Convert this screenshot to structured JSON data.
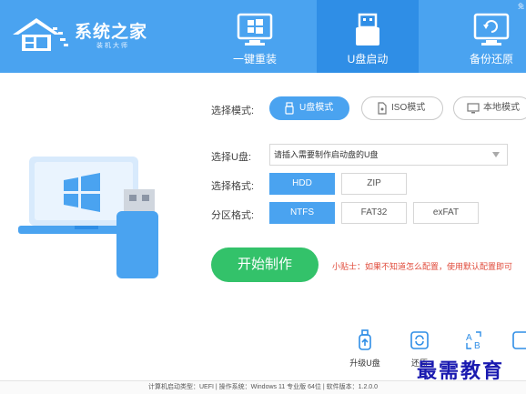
{
  "app": {
    "title": "系统之家",
    "subtitle": "装机大师",
    "corner_text": "免"
  },
  "nav": {
    "tabs": [
      {
        "label": "一键重装",
        "icon": "windows-monitor-icon",
        "active": false
      },
      {
        "label": "U盘启动",
        "icon": "usb-drive-icon",
        "active": true
      },
      {
        "label": "备份还原",
        "icon": "backup-restore-icon",
        "active": false
      }
    ]
  },
  "mode": {
    "label": "选择模式:",
    "options": [
      {
        "label": "U盘模式",
        "icon": "usb-icon",
        "active": true
      },
      {
        "label": "ISO模式",
        "icon": "disc-icon",
        "active": false
      },
      {
        "label": "本地模式",
        "icon": "monitor-icon",
        "active": false
      }
    ]
  },
  "usb_select": {
    "label": "选择U盘:",
    "value": "请插入需要制作启动盘的U盘"
  },
  "format": {
    "label": "选择格式:",
    "options": [
      {
        "label": "HDD",
        "active": true
      },
      {
        "label": "ZIP",
        "active": false
      }
    ]
  },
  "partition": {
    "label": "分区格式:",
    "options": [
      {
        "label": "NTFS",
        "active": true
      },
      {
        "label": "FAT32",
        "active": false
      },
      {
        "label": "exFAT",
        "active": false
      }
    ]
  },
  "start_button": "开始制作",
  "tip": "小贴士：如果不知道怎么配置，使用默认配置即可",
  "tools": [
    {
      "label": "升级U盘",
      "icon": "usb-upgrade-icon"
    },
    {
      "label": "还原",
      "icon": "restore-icon"
    },
    {
      "label": "",
      "icon": "text-convert-icon"
    },
    {
      "label": "",
      "icon": "shortcut-icon"
    }
  ],
  "watermark": "最需教育",
  "status_bar": "计算机启动类型：UEFI | 操作系统：Windows 11 专业版 64位 | 软件版本：1.2.0.0",
  "colors": {
    "header_blue": "#4aa3f0",
    "active_tab_blue": "#2f8ee6",
    "start_green": "#33c26a",
    "tip_red": "#e04a3a"
  }
}
